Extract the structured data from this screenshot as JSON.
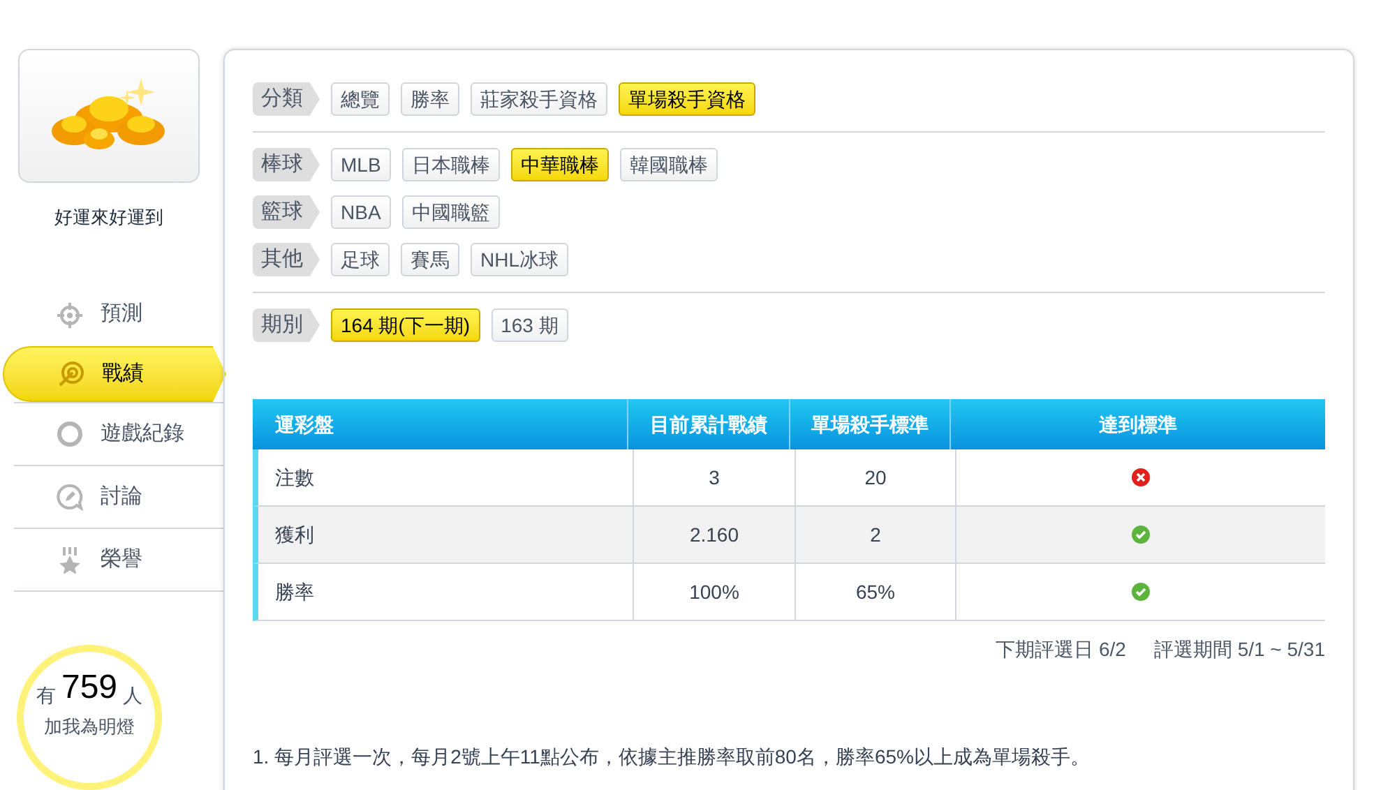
{
  "profile": {
    "name": "好運來好運到"
  },
  "nav": [
    {
      "label": "預測",
      "kind": "target",
      "selected": false
    },
    {
      "label": "戰績",
      "kind": "dart",
      "selected": true
    },
    {
      "label": "遊戲紀錄",
      "kind": "ring",
      "selected": false
    },
    {
      "label": "討論",
      "kind": "chat",
      "selected": false
    },
    {
      "label": "榮譽",
      "kind": "medal",
      "selected": false
    }
  ],
  "fans": {
    "prefix": "有",
    "count": "759",
    "suffix": "人",
    "caption": "加我為明燈"
  },
  "filters": [
    {
      "label": "分類",
      "options": [
        {
          "label": "總覽",
          "selected": false
        },
        {
          "label": "勝率",
          "selected": false
        },
        {
          "label": "莊家殺手資格",
          "selected": false
        },
        {
          "label": "單場殺手資格",
          "selected": true
        }
      ],
      "divider_after": true
    },
    {
      "label": "棒球",
      "options": [
        {
          "label": "MLB",
          "selected": false
        },
        {
          "label": "日本職棒",
          "selected": false
        },
        {
          "label": "中華職棒",
          "selected": true
        },
        {
          "label": "韓國職棒",
          "selected": false
        }
      ],
      "divider_after": false
    },
    {
      "label": "籃球",
      "options": [
        {
          "label": "NBA",
          "selected": false
        },
        {
          "label": "中國職籃",
          "selected": false
        }
      ],
      "divider_after": false
    },
    {
      "label": "其他",
      "options": [
        {
          "label": "足球",
          "selected": false
        },
        {
          "label": "賽馬",
          "selected": false
        },
        {
          "label": "NHL冰球",
          "selected": false
        }
      ],
      "divider_after": true
    },
    {
      "label": "期別",
      "options": [
        {
          "label": "164 期(下一期)",
          "selected": true
        },
        {
          "label": "163 期",
          "selected": false
        }
      ],
      "divider_after": false
    }
  ],
  "table": {
    "columns": [
      "運彩盤",
      "目前累計戰績",
      "單場殺手標準",
      "達到標準"
    ],
    "rows": [
      {
        "item": "注數",
        "current": "3",
        "standard": "20",
        "met": false
      },
      {
        "item": "獲利",
        "current": "2.160",
        "standard": "2",
        "met": true
      },
      {
        "item": "勝率",
        "current": "100%",
        "standard": "65%",
        "met": true
      }
    ]
  },
  "schedule": {
    "next_date": "下期評選日 6/2",
    "period": "評選期間 5/1 ~ 5/31"
  },
  "notes": [
    "1. 每月評選一次，每月2號上午11點公布，依據主推勝率取前80名，勝率65%以上成為單場殺手。"
  ]
}
